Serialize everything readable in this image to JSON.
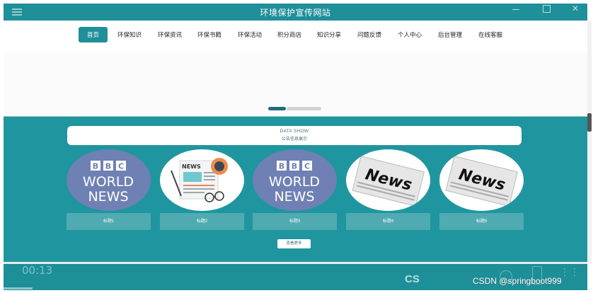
{
  "window": {
    "title": "环境保护宣传网站"
  },
  "nav": {
    "items": [
      {
        "label": "首页",
        "active": true
      },
      {
        "label": "环保知识"
      },
      {
        "label": "环保资讯"
      },
      {
        "label": "环保书籍"
      },
      {
        "label": "环保活动"
      },
      {
        "label": "积分商店"
      },
      {
        "label": "知识分享"
      },
      {
        "label": "问题反馈"
      },
      {
        "label": "个人中心"
      },
      {
        "label": "后台管理"
      },
      {
        "label": "在线客服"
      }
    ]
  },
  "banner": {
    "active_slide": 1,
    "slide_count": 2
  },
  "section": {
    "title_en": "DATA SHOW",
    "title_cn": "公告信息展示",
    "cards": [
      {
        "caption": "标题1",
        "image": "bbc-world-news-logo"
      },
      {
        "caption": "标题2",
        "image": "newspaper-illustration"
      },
      {
        "caption": "标题3",
        "image": "bbc-world-news-logo"
      },
      {
        "caption": "标题4",
        "image": "news-newspaper-text"
      },
      {
        "caption": "标题5",
        "image": "news-newspaper-text"
      }
    ],
    "more_button": "查看更多"
  },
  "player": {
    "time": "00:13",
    "progress": 0.05
  },
  "watermark": "CSDN @springboot999",
  "colors": {
    "primary": "#1f8f99",
    "section_bg": "#1f969f",
    "caption_bg": "#50aab1"
  }
}
